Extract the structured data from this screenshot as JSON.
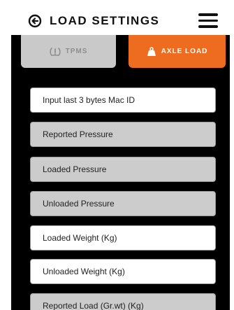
{
  "header": {
    "title": "LOAD SETTINGS",
    "back_icon": "circle-arrow-left-icon",
    "menu_icon": "hamburger-menu-icon"
  },
  "tabs": [
    {
      "label": "TPMS",
      "icon": "tire-pressure-icon",
      "active": false
    },
    {
      "label": "AXLE LOAD",
      "icon": "weight-icon",
      "active": true
    }
  ],
  "fields": [
    {
      "placeholder": "Input last 3 bytes Mac ID",
      "editable": true
    },
    {
      "placeholder": "Reported Pressure",
      "editable": false
    },
    {
      "placeholder": "Loaded Pressure",
      "editable": false
    },
    {
      "placeholder": "Unloaded Pressure",
      "editable": false
    },
    {
      "placeholder": "Loaded Weight (Kg)",
      "editable": true
    },
    {
      "placeholder": "Unloaded Weight (Kg)",
      "editable": true
    },
    {
      "placeholder": "Reported Load (Gr.wt) (Kg)",
      "editable": false
    }
  ],
  "colors": {
    "accent": "#ee6c1f",
    "panel": "#000000",
    "tab_inactive": "#c9c9c9",
    "field_readonly": "#cccccc",
    "field_editable": "#ffffff"
  }
}
